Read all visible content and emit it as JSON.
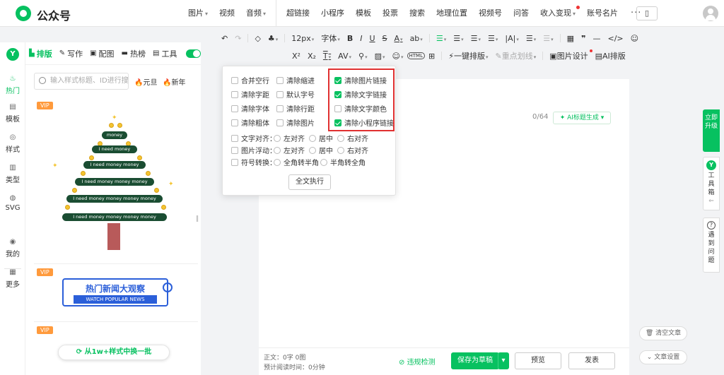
{
  "app": {
    "brand": "公众号"
  },
  "topnav": {
    "items": [
      {
        "label": "图片",
        "dropdown": true
      },
      {
        "label": "视频",
        "dropdown": false
      },
      {
        "label": "音频",
        "dropdown": true
      },
      {
        "label": "超链接",
        "dropdown": false
      },
      {
        "label": "小程序",
        "dropdown": false
      },
      {
        "label": "模板",
        "dropdown": false
      },
      {
        "label": "投票",
        "dropdown": false
      },
      {
        "label": "搜索",
        "dropdown": false
      },
      {
        "label": "地理位置",
        "dropdown": false
      },
      {
        "label": "视频号",
        "dropdown": false
      },
      {
        "label": "问答",
        "dropdown": false
      },
      {
        "label": "收入变现",
        "dropdown": true
      },
      {
        "label": "账号名片",
        "dropdown": false
      }
    ],
    "more": "···"
  },
  "toolbar1": {
    "undo": "↶",
    "redo": "↷",
    "eraser": "◇",
    "brush": "♣",
    "font_size": "12px",
    "font_family": "字体",
    "bold": "B",
    "italic": "I",
    "underline": "U",
    "strike": "S",
    "font_color": "A",
    "bg_color": "ab",
    "align_left": "☰",
    "align_center": "☰",
    "align_right": "☰",
    "line_height": "☰",
    "indent": "|A|",
    "letter_spacing": "☰",
    "list": "☰",
    "table": "▦",
    "quote": "❞",
    "hr": "—",
    "code": "</>",
    "emoji": "☺"
  },
  "toolbar2": {
    "superscript": "X²",
    "subscript": "X₂",
    "paragraph": "T",
    "av": "AV",
    "wand": "⚲",
    "image": "▨",
    "emoji2": "☺",
    "html": "HTML",
    "tool": "⊞",
    "one_click": "一键排版",
    "key_line": "重点划线",
    "image_design": "图片设计",
    "ai_layout": "AI排版"
  },
  "rail": {
    "items": [
      {
        "icon": "♨",
        "label": "热门",
        "active": true
      },
      {
        "icon": "▤",
        "label": "模板",
        "active": false
      },
      {
        "icon": "◎",
        "label": "样式",
        "active": false
      },
      {
        "icon": "▥",
        "label": "类型",
        "active": false
      },
      {
        "icon": "◍",
        "label": "SVG",
        "active": false
      },
      {
        "icon": "◉",
        "label": "我的",
        "active": false
      },
      {
        "icon": "▦",
        "label": "更多",
        "active": false
      }
    ]
  },
  "panel": {
    "tabs": [
      {
        "icon": "▙",
        "label": "排版",
        "active": true
      },
      {
        "icon": "✎",
        "label": "写作",
        "active": false
      },
      {
        "icon": "▣",
        "label": "配图",
        "active": false
      },
      {
        "icon": "▬",
        "label": "热榜",
        "active": false
      },
      {
        "icon": "▤",
        "label": "工具",
        "active": false
      }
    ],
    "toggle_on": true,
    "search_placeholder": "输入样式标题、ID进行搜索",
    "hot1": "元旦",
    "hot2": "新年",
    "vip_badge": "VIP",
    "tree_labels": [
      "money",
      "I need money",
      "I need money money",
      "I need money money money",
      "I need money money money money",
      "I need money money money money"
    ],
    "card2_title": "热门新闻大观察",
    "card2_sub": "WATCH POPULAR NEWS",
    "swap_label": "从1w+样式中换一批"
  },
  "popup": {
    "col1": [
      "合并空行",
      "清除字距",
      "清除字体",
      "清除粗体"
    ],
    "col2": [
      "清除缩进",
      "默认字号",
      "清除行距",
      "清除图片"
    ],
    "col3": [
      {
        "label": "清除图片链接",
        "checked": true
      },
      {
        "label": "清除文字链接",
        "checked": true
      },
      {
        "label": "清除文字颜色",
        "checked": false
      },
      {
        "label": "清除小程序链接",
        "checked": true
      }
    ],
    "row_text_align": {
      "label": "文字对齐：",
      "options": [
        "左对齐",
        "居中",
        "右对齐"
      ]
    },
    "row_image_float": {
      "label": "图片浮动：",
      "options": [
        "左对齐",
        "居中",
        "右对齐"
      ]
    },
    "row_symbol": {
      "label": "符号转换：",
      "options": [
        "全角转半角",
        "半角转全角"
      ]
    },
    "run_button": "全文执行"
  },
  "editor": {
    "title_count": "0/64",
    "ai_title": "AI标题生成",
    "stats_line1": "正文：0字 0图",
    "stats_line2": "预计阅读时间：0分钟",
    "check": "违规检测",
    "save_draft": "保存为草稿",
    "preview": "预览",
    "publish": "发表"
  },
  "side": {
    "cta": "立即升级",
    "toolbox_icon": "Y",
    "toolbox": "工具箱",
    "help": "遇到问题",
    "clear": "清空文章",
    "settings": "文章设置"
  },
  "colors": {
    "accent": "#07c160",
    "highlight_box": "#e03030",
    "vip": "#ff9a3c",
    "banner_blue": "#2b5fd9"
  }
}
